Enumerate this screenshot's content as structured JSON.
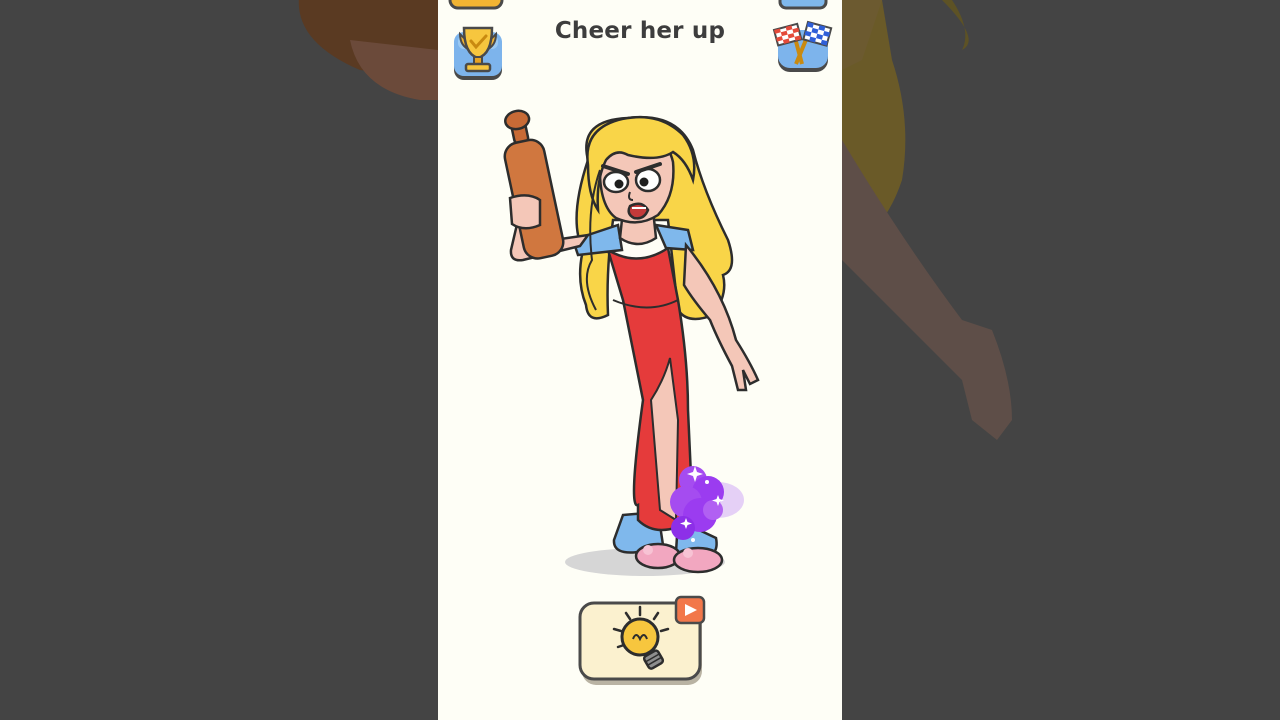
{
  "level": {
    "title": "Cheer her up"
  },
  "buttons": {
    "trophy_icon": "trophy-icon",
    "flags_icon": "checkered-flags-icon",
    "hint_icon": "lightbulb-icon",
    "video_icon": "play-video-icon"
  },
  "colors": {
    "panel_background": "#fefef6",
    "side_background": "#444444",
    "title_text": "#3d3d3d",
    "dress": "#e53b3b",
    "hair": "#f9d548",
    "slippers": "#7fb8ec",
    "magic_smoke": "#9b3cf0",
    "hint_button_bg": "#fbf1cf",
    "video_badge": "#f2774a"
  }
}
